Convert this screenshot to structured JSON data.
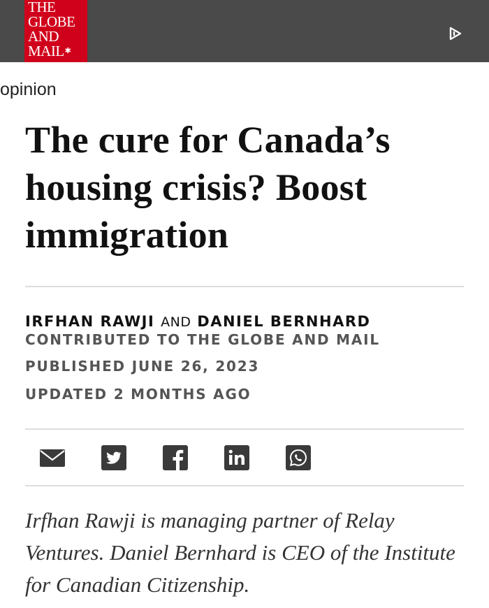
{
  "header": {
    "logo_lines": [
      "THE",
      "GLOBE",
      "AND",
      "MAIL"
    ],
    "logo_leaf_icon": "maple-leaf-icon",
    "play_icon": "play-icon",
    "colors": {
      "bar": "#4a4a4a",
      "logo": "#d0021b"
    }
  },
  "article": {
    "section": "opinion",
    "headline": "The cure for Canada’s housing crisis? Boost immigration",
    "byline": {
      "author1": "IRFHAN RAWJI",
      "conjunction": "AND",
      "author2": "DANIEL BERNHARD",
      "contributed": "CONTRIBUTED TO THE GLOBE AND MAIL"
    },
    "published": "PUBLISHED JUNE 26, 2023",
    "updated": "UPDATED 2 MONTHS AGO",
    "share_icons": [
      "email-icon",
      "twitter-icon",
      "facebook-icon",
      "linkedin-icon",
      "whatsapp-icon"
    ],
    "intro": "Irfhan Rawji is managing partner of Relay Ventures. Daniel Bernhard is CEO of the Institute for Canadian Citizenship."
  }
}
